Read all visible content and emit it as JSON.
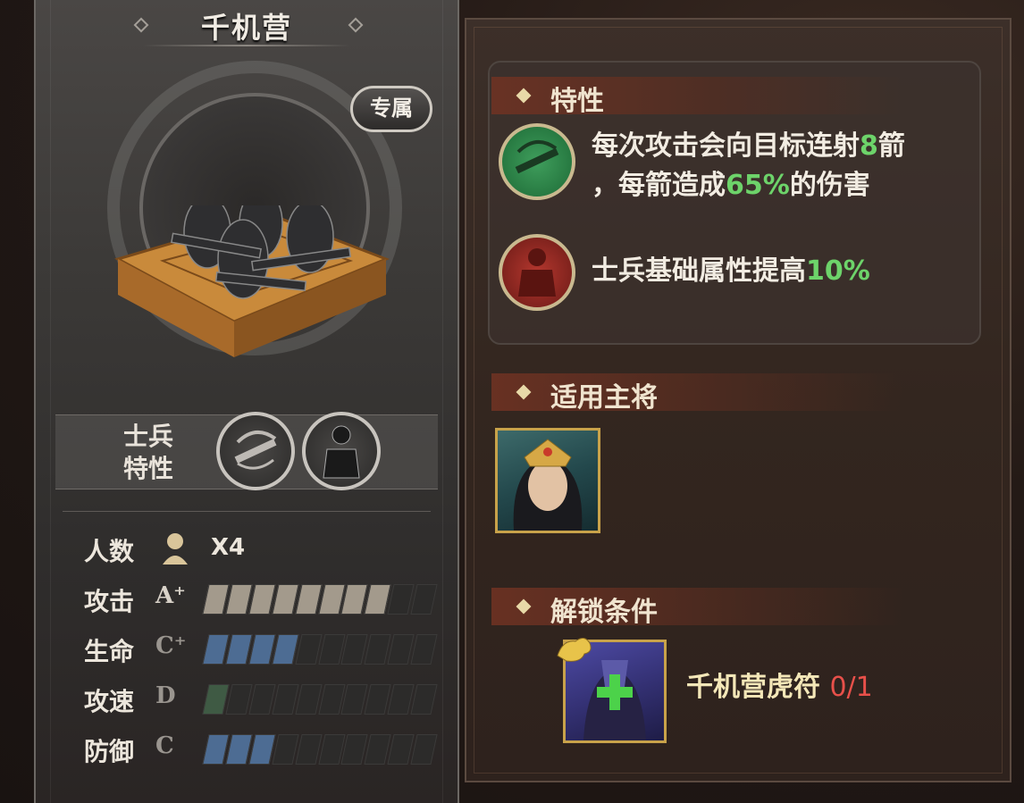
{
  "unit": {
    "name": "千机营",
    "badge": "专属",
    "traits_label_line1": "士兵",
    "traits_label_line2": "特性",
    "trait_icons": [
      "crossbow-icon",
      "soldier-icon"
    ]
  },
  "stats": {
    "count_label": "人数",
    "count_value": "X4",
    "rows": [
      {
        "label": "攻击",
        "grade": "A⁺",
        "filled": 8,
        "total": 10,
        "color": "#a39a8c"
      },
      {
        "label": "生命",
        "grade": "C⁺",
        "filled": 4,
        "total": 10,
        "color": "#4d6c93"
      },
      {
        "label": "攻速",
        "grade": "D",
        "filled": 1,
        "total": 10,
        "color": "#3f5a44"
      },
      {
        "label": "防御",
        "grade": "C",
        "filled": 3,
        "total": 10,
        "color": "#4d6c93"
      }
    ]
  },
  "features": {
    "title": "特性",
    "items": [
      {
        "icon": "crossbow-icon",
        "line1_a": "每次攻击会向目标连射",
        "line1_hl": "8",
        "line1_b": "箭",
        "line2_a": "，每箭造成",
        "line2_hl": "65%",
        "line2_b": "的伤害"
      },
      {
        "icon": "soldier-icon",
        "line1_a": "士兵基础属性提高",
        "line1_hl": "10%"
      }
    ]
  },
  "generals": {
    "title": "适用主将"
  },
  "unlock": {
    "title": "解锁条件",
    "item_name": "千机营虎符",
    "progress": "0/1"
  },
  "colors": {
    "highlight": "#6dd36a",
    "gold": "#c8a24a",
    "red": "#e8504a"
  }
}
